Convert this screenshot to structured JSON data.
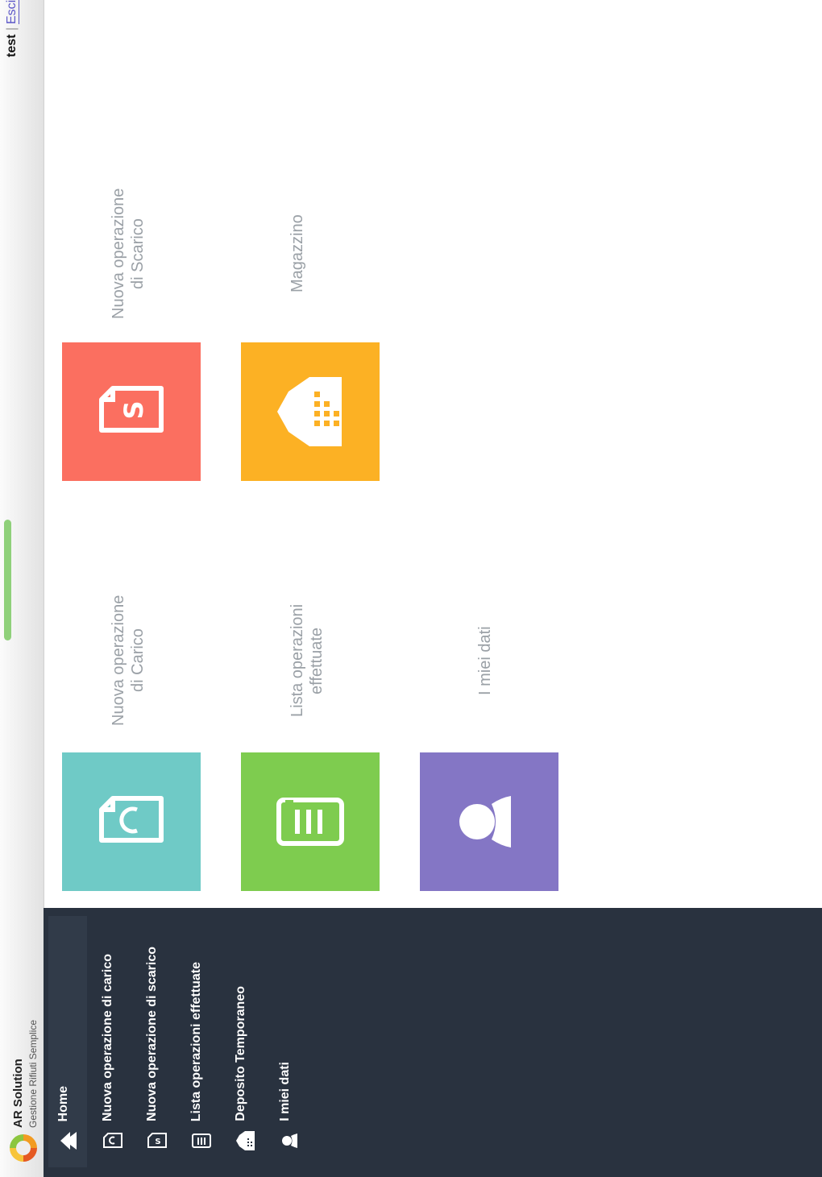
{
  "header": {
    "user": "test",
    "separator": "|",
    "logout_label": "Esci"
  },
  "brand": {
    "name": "AR Solution",
    "subtitle": "Gestione Rifiuti Semplice"
  },
  "sidebar": {
    "items": [
      {
        "label": "Home",
        "icon": "home-icon"
      },
      {
        "label": "Nuova operazione di carico",
        "icon": "carico-document-icon"
      },
      {
        "label": "Nuova operazione di scarico",
        "icon": "scarico-document-icon"
      },
      {
        "label": "Lista operazioni effettuate",
        "icon": "list-chart-icon"
      },
      {
        "label": "Deposito Temporaneo",
        "icon": "warehouse-icon"
      },
      {
        "label": "I miei dati",
        "icon": "user-icon"
      }
    ]
  },
  "tiles": {
    "carico": {
      "label": "Nuova operazione\ndi Carico",
      "color": "#6fcac6",
      "icon": "carico-document-icon"
    },
    "scarico": {
      "label": "Nuova operazione\ndi Scarico",
      "color": "#fb6f60",
      "icon": "scarico-document-icon"
    },
    "lista": {
      "label": "Lista operazioni\neffettuate",
      "color": "#7ecc4f",
      "icon": "list-chart-icon"
    },
    "magazzino": {
      "label": "Magazzino",
      "color": "#fcb124",
      "icon": "warehouse-icon"
    },
    "dati": {
      "label": "I miei dati",
      "color": "#8476c5",
      "icon": "user-icon"
    }
  }
}
